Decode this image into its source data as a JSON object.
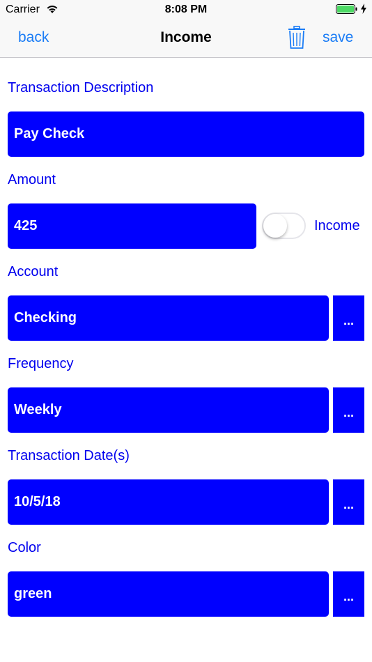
{
  "status_bar": {
    "carrier": "Carrier",
    "time": "8:08 PM",
    "wifi_icon": "wifi-icon",
    "battery_icon": "battery-icon",
    "charging_icon": "bolt-icon"
  },
  "nav": {
    "back_label": "back",
    "title": "Income",
    "delete_icon": "trash-icon",
    "save_label": "save"
  },
  "form": {
    "description": {
      "label": "Transaction Description",
      "value": "Pay Check"
    },
    "amount": {
      "label": "Amount",
      "value": "425",
      "toggle_label": "Income",
      "toggle_on": false
    },
    "account": {
      "label": "Account",
      "value": "Checking",
      "more_label": "..."
    },
    "frequency": {
      "label": "Frequency",
      "value": "Weekly",
      "more_label": "..."
    },
    "date": {
      "label": "Transaction Date(s)",
      "value": "10/5/18",
      "more_label": "..."
    },
    "color": {
      "label": "Color",
      "value": "green",
      "more_label": "..."
    }
  },
  "colors": {
    "accent": "#1a7cf6",
    "field_bg": "#0000ff",
    "label": "#0000ee"
  }
}
